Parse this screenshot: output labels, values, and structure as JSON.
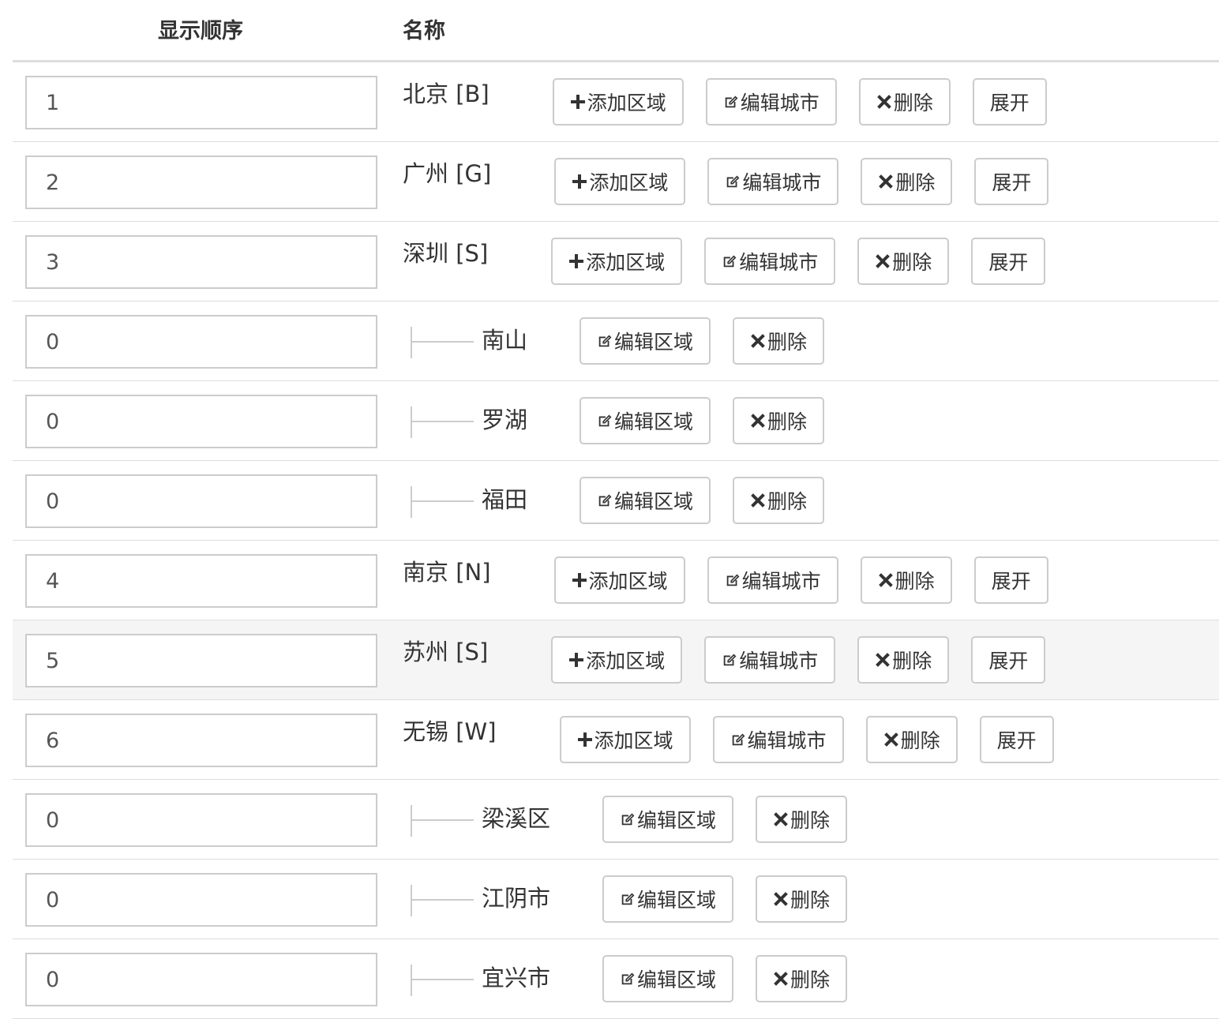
{
  "header": {
    "order_label": "显示顺序",
    "name_label": "名称"
  },
  "labels": {
    "add_area": "添加区域",
    "edit_city": "编辑城市",
    "edit_area": "编辑区域",
    "delete": "删除",
    "expand": "展开"
  },
  "rows": [
    {
      "type": "city",
      "order": "1",
      "name": "北京 [B]"
    },
    {
      "type": "city",
      "order": "2",
      "name": "广州 [G]"
    },
    {
      "type": "city",
      "order": "3",
      "name": "深圳 [S]"
    },
    {
      "type": "area",
      "order": "0",
      "name": "南山"
    },
    {
      "type": "area",
      "order": "0",
      "name": "罗湖"
    },
    {
      "type": "area",
      "order": "0",
      "name": "福田"
    },
    {
      "type": "city",
      "order": "4",
      "name": "南京 [N]"
    },
    {
      "type": "city",
      "order": "5",
      "name": "苏州 [S]",
      "hover": true
    },
    {
      "type": "city",
      "order": "6",
      "name": "无锡 [W]"
    },
    {
      "type": "area",
      "order": "0",
      "name": "梁溪区"
    },
    {
      "type": "area",
      "order": "0",
      "name": "江阴市"
    },
    {
      "type": "area",
      "order": "0",
      "name": "宜兴市"
    }
  ]
}
